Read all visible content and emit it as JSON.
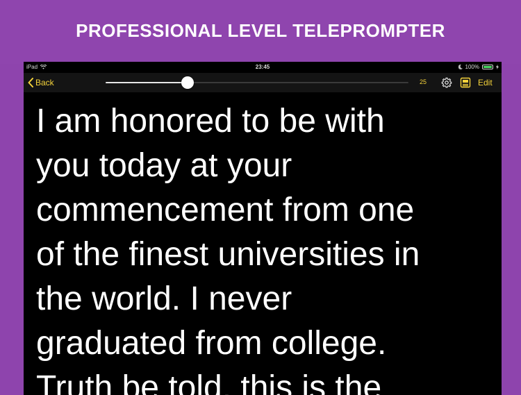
{
  "banner": {
    "title": "PROFESSIONAL LEVEL TELEPROMPTER"
  },
  "status_bar": {
    "device": "iPad",
    "time": "23:45",
    "battery": "100%"
  },
  "toolbar": {
    "back_label": "Back",
    "scroll_position": 0.27,
    "speed_value": "25",
    "edit_label": "Edit"
  },
  "script": {
    "lines": [
      "I am honored to be with",
      "you today at your",
      "commencement from one",
      "of the finest universities in",
      "the world. I never",
      "graduated from college.",
      "Truth be told, this is the"
    ]
  },
  "colors": {
    "background": "#8e44ad",
    "accent": "#f5d33b",
    "screen": "#000000",
    "battery": "#4cd964"
  },
  "icons": [
    "wifi-icon",
    "moon-icon",
    "battery-icon",
    "charging-icon",
    "chevron-left-icon",
    "gear-icon",
    "mirror-icon"
  ]
}
